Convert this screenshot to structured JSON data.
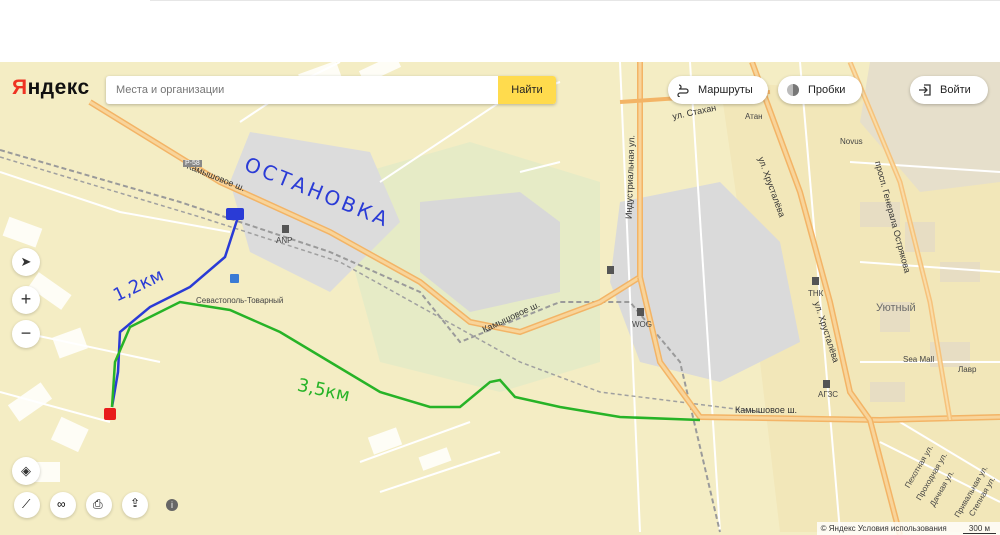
{
  "header": {
    "logo": "Яндекс",
    "search_placeholder": "Места и организации",
    "search_button": "Найти",
    "routes_button": "Маршруты",
    "traffic_button": "Пробки",
    "login_button": "Войти"
  },
  "map": {
    "streets": {
      "kamyshovoe_1": "Камышовое ш.",
      "kamyshovoe_2": "Камышовое ш.",
      "kamyshovoe_3": "Камышовое ш.",
      "industrial": "Индустриальная ул.",
      "khrustaleva_1": "ул. Хрусталёва",
      "khrustaleva_2": "ул. Хрусталёва",
      "ostryakova": "просп. Генерала Острякова",
      "stakhanov": "ул. Стахан",
      "r58": "Р-58",
      "pekhotnaya": "Пехотная ул.",
      "prokhodnaya": "Проходная ул.",
      "dachnaya": "Дачная ул.",
      "privalnaya": "Привальная ул.",
      "stepnaya": "Степная ул."
    },
    "pois": {
      "station": "Севастополь-Товарный",
      "anp": "ANP",
      "wog": "WOG",
      "tnk": "ТНК",
      "ags": "АГЗС",
      "atan": "Атан",
      "novus": "Novus",
      "seamall": "Sea Mall",
      "lavr": "Лавр",
      "district": "Уютный"
    },
    "annotations": {
      "stop": "ОСТАНОВКА",
      "blue_distance": "1,2км",
      "green_distance": "3,5км"
    },
    "colors": {
      "blue_route": "#2a3bd6",
      "green_route": "#27b327",
      "stop_marker": "#2a3bd6",
      "start_marker": "#e81c1c"
    }
  },
  "footer": {
    "copyright": "© Яндекс Условия использования",
    "scale": "300 м"
  }
}
